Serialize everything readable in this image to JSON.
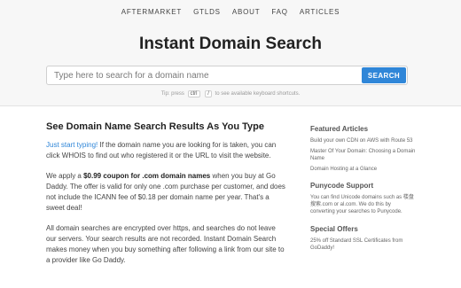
{
  "nav": {
    "items": [
      "AFTERMARKET",
      "GTLDS",
      "ABOUT",
      "FAQ",
      "ARTICLES"
    ]
  },
  "header": {
    "title": "Instant Domain Search"
  },
  "search": {
    "placeholder": "Type here to search for a domain name",
    "button_label": "SEARCH"
  },
  "tip": {
    "prefix": "Tip: press",
    "key1": "ctrl",
    "key2": "/",
    "suffix": "to see available keyboard shortcuts."
  },
  "main": {
    "heading": "See Domain Name Search Results As You Type",
    "p1_link": "Just start typing!",
    "p1_rest": " If the domain name you are looking for is taken, you can click WHOIS to find out who registered it or the URL to visit the website.",
    "p2_a": "We apply a ",
    "p2_bold": "$0.99 coupon for .com domain names",
    "p2_b": " when you buy at Go Daddy. The offer is valid for only one .com purchase per customer, and does not include the ICANN fee of $0.18 per domain name per year. That's a sweet deal!",
    "p3": "All domain searches are encrypted over https, and searches do not leave our servers. Your search results are not recorded. Instant Domain Search makes money when you buy something after following a link from our site to a provider like Go Daddy."
  },
  "sidebar": {
    "featured_title": "Featured Articles",
    "articles": [
      "Build your own CDN on AWS with Route 53",
      "Master Of Your Domain: Choosing a Domain Name",
      "Domain Hosting at a Glance"
    ],
    "punycode_title": "Punycode Support",
    "punycode_text": "You can find Unicode domains such as 楼盘搜索.com or al.com. We do this by converting your searches to Punycode.",
    "offers_title": "Special Offers",
    "offers_text": "25% off Standard SSL Certificates from GoDaddy!"
  }
}
